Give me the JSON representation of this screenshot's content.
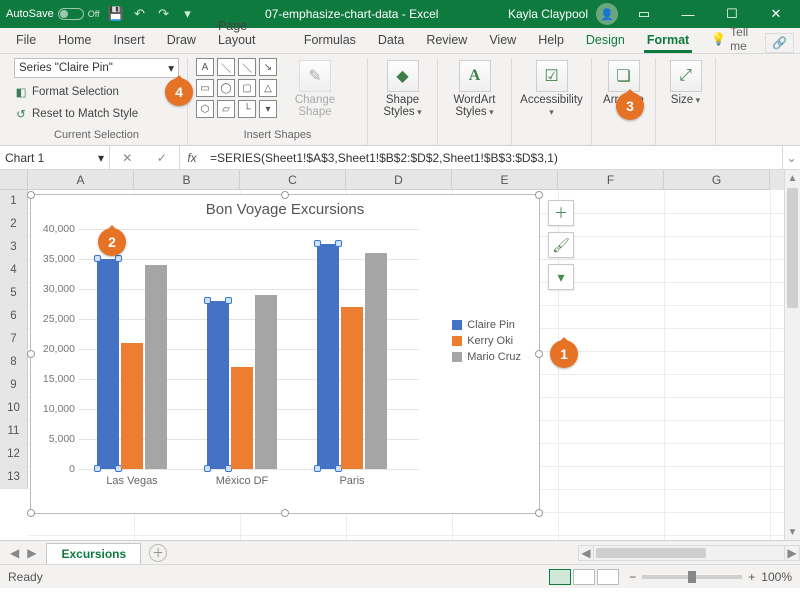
{
  "titlebar": {
    "autosave_label": "AutoSave",
    "autosave_state": "Off",
    "doc_title": "07-emphasize-chart-data - Excel",
    "user_name": "Kayla Claypool"
  },
  "tabs": {
    "items": [
      "File",
      "Home",
      "Insert",
      "Draw",
      "Page Layout",
      "Formulas",
      "Data",
      "Review",
      "View",
      "Help",
      "Design",
      "Format"
    ],
    "active": "Format",
    "tellme_placeholder": "Tell me"
  },
  "ribbon": {
    "current_selection": {
      "dropdown_value": "Series \"Claire Pin\"",
      "format_selection": "Format Selection",
      "reset": "Reset to Match Style",
      "group_label": "Current Selection"
    },
    "insert_shapes": {
      "group_label": "Insert Shapes",
      "change_shape": "Change Shape"
    },
    "shape_styles": "Shape Styles",
    "wordart_styles": "WordArt Styles",
    "accessibility": "Accessibility",
    "arrange": "Arrange",
    "size": "Size"
  },
  "namebox": {
    "value": "Chart 1"
  },
  "formula_bar": {
    "fx_label": "fx",
    "formula": "=SERIES(Sheet1!$A$3,Sheet1!$B$2:$D$2,Sheet1!$B$3:$D$3,1)"
  },
  "columns": [
    "A",
    "B",
    "C",
    "D",
    "E",
    "F",
    "G"
  ],
  "rows": [
    "1",
    "2",
    "3",
    "4",
    "5",
    "6",
    "7",
    "8",
    "9",
    "10",
    "11",
    "12",
    "13"
  ],
  "cell_a1": "Bon Voyage Excursions",
  "chart_data": {
    "type": "bar",
    "title": "Bon Voyage Excursions",
    "categories": [
      "Las Vegas",
      "México DF",
      "Paris"
    ],
    "series": [
      {
        "name": "Claire Pin",
        "values": [
          35000,
          28000,
          37500
        ]
      },
      {
        "name": "Kerry Oki",
        "values": [
          21000,
          17000,
          27000
        ]
      },
      {
        "name": "Mario Cruz",
        "values": [
          34000,
          29000,
          36000
        ]
      }
    ],
    "ylim": [
      0,
      40000
    ],
    "ytick": 5000,
    "yticks": [
      "0",
      "5,000",
      "10,000",
      "15,000",
      "20,000",
      "25,000",
      "30,000",
      "35,000",
      "40,000"
    ],
    "selected_series": 0,
    "colors": [
      "#4472c4",
      "#ed7d31",
      "#a5a5a5"
    ]
  },
  "chart_side_buttons": [
    "chart-elements",
    "chart-styles",
    "chart-filters"
  ],
  "sheet_tab": {
    "name": "Excursions"
  },
  "statusbar": {
    "state": "Ready",
    "zoom": "100%"
  },
  "callouts": {
    "1": "1",
    "2": "2",
    "3": "3",
    "4": "4"
  }
}
